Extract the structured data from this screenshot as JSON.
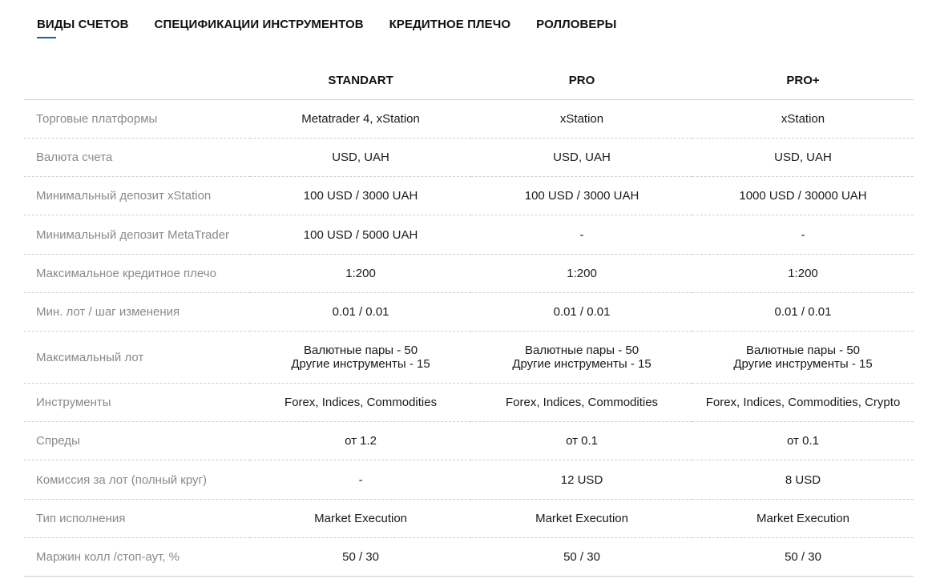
{
  "tabs": [
    {
      "label": "ВИДЫ СЧЕТОВ",
      "active": true
    },
    {
      "label": "СПЕЦИФИКАЦИИ ИНСТРУМЕНТОВ",
      "active": false
    },
    {
      "label": "КРЕДИТНОЕ ПЛЕЧО",
      "active": false
    },
    {
      "label": "РОЛЛОВЕРЫ",
      "active": false
    }
  ],
  "accent_color": "#1f5fa8",
  "table": {
    "columns": [
      "STANDART",
      "PRO",
      "PRO+"
    ],
    "rows": [
      {
        "label": "Торговые платформы",
        "values": [
          "Metatrader 4, xStation",
          "xStation",
          "xStation"
        ]
      },
      {
        "label": "Валюта счета",
        "values": [
          "USD, UAH",
          "USD, UAH",
          "USD, UAH"
        ]
      },
      {
        "label": "Минимальный депозит xStation",
        "values": [
          "100 USD / 3000 UAH",
          "100 USD / 3000 UAH",
          "1000 USD / 30000 UAH"
        ]
      },
      {
        "label": "Минимальный депозит MetaTrader",
        "values": [
          "100 USD / 5000 UAH",
          "-",
          "-"
        ]
      },
      {
        "label": "Максимальное кредитное плечо",
        "values": [
          "1:200",
          "1:200",
          "1:200"
        ]
      },
      {
        "label": "Мин. лот / шаг изменения",
        "values": [
          "0.01 / 0.01",
          "0.01 / 0.01",
          "0.01 / 0.01"
        ]
      },
      {
        "label": "Максимальный лот",
        "values": [
          [
            "Валютные пары - 50",
            "Другие инструменты - 15"
          ],
          [
            "Валютные пары - 50",
            "Другие инструменты - 15"
          ],
          [
            "Валютные пары - 50",
            "Другие инструменты - 15"
          ]
        ]
      },
      {
        "label": "Инструменты",
        "values": [
          "Forex, Indices, Commodities",
          "Forex, Indices, Commodities",
          "Forex, Indices, Commodities, Crypto"
        ]
      },
      {
        "label": "Спреды",
        "values": [
          "от 1.2",
          "от 0.1",
          "от 0.1"
        ]
      },
      {
        "label": "Комиссия за лот (полный круг)",
        "values": [
          "-",
          "12 USD",
          "8 USD"
        ]
      },
      {
        "label": "Тип исполнения",
        "values": [
          "Market Execution",
          "Market Execution",
          "Market Execution"
        ]
      },
      {
        "label": "Маржин колл /стоп-аут, %",
        "values": [
          "50 / 30",
          "50 / 30",
          "50 / 30"
        ]
      }
    ]
  }
}
